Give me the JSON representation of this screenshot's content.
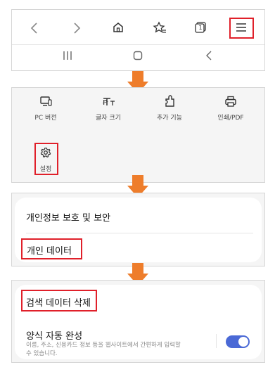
{
  "panel1": {
    "toolbar": [
      {
        "name": "back-icon"
      },
      {
        "name": "forward-icon"
      },
      {
        "name": "home-icon"
      },
      {
        "name": "bookmark-star-icon"
      },
      {
        "name": "tabs-icon",
        "badge": "1"
      },
      {
        "name": "menu-icon"
      }
    ],
    "system_nav": [
      {
        "name": "recent-apps-icon"
      },
      {
        "name": "home-nav-icon"
      },
      {
        "name": "back-nav-icon"
      }
    ]
  },
  "panel2": {
    "items": [
      {
        "label": "PC 버전"
      },
      {
        "label": "글자 크기"
      },
      {
        "label": "추가 기능"
      },
      {
        "label": "인쇄/PDF"
      }
    ],
    "settings_label": "설정"
  },
  "panel3": {
    "privacy_label": "개인정보 보호 및 보안",
    "personal_data_label": "개인 데이터"
  },
  "panel4": {
    "delete_data_label": "검색 데이터 삭제",
    "autofill_title": "양식 자동 완성",
    "autofill_desc": "이름, 주소, 신용카드 정보 등을 웹사이트에서 간편하게 입력할 수 있습니다.",
    "autofill_enabled": true
  },
  "colors": {
    "highlight": "#e0202a",
    "arrow": "#ee7d2b",
    "toggle_on": "#4a69d6"
  }
}
